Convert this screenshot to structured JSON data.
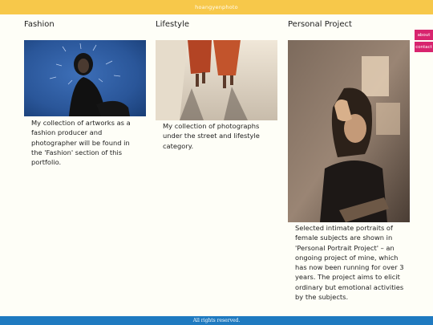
{
  "header": {
    "brand": "hoangyenphoto"
  },
  "columns": [
    {
      "title": "Fashion",
      "description": "My collection of artworks as a fashion producer and photographer will be found in the 'Fashion' section of this portfolio.",
      "image": "fashion-photo"
    },
    {
      "title": "Lifestyle",
      "description": "My collection of photographs under the street and lifestyle category.",
      "image": "lifestyle-photo"
    },
    {
      "title": "Personal Project",
      "description": "Selected intimate portraits of female subjects are shown in 'Personal Portrait Project' – an ongoing project of mine, which has now been running for over 3 years. The project aims to elicit ordinary but emotional activities by the subjects.",
      "image": "personal-project-photo"
    }
  ],
  "side_nav": {
    "about": "about",
    "contact": "contact"
  },
  "footer": {
    "text": "All rights reserved."
  },
  "colors": {
    "header_bg": "#f7c84a",
    "footer_bg": "#1f7ac0",
    "side_tab_bg": "#d8246e",
    "page_bg": "#fefef7"
  }
}
